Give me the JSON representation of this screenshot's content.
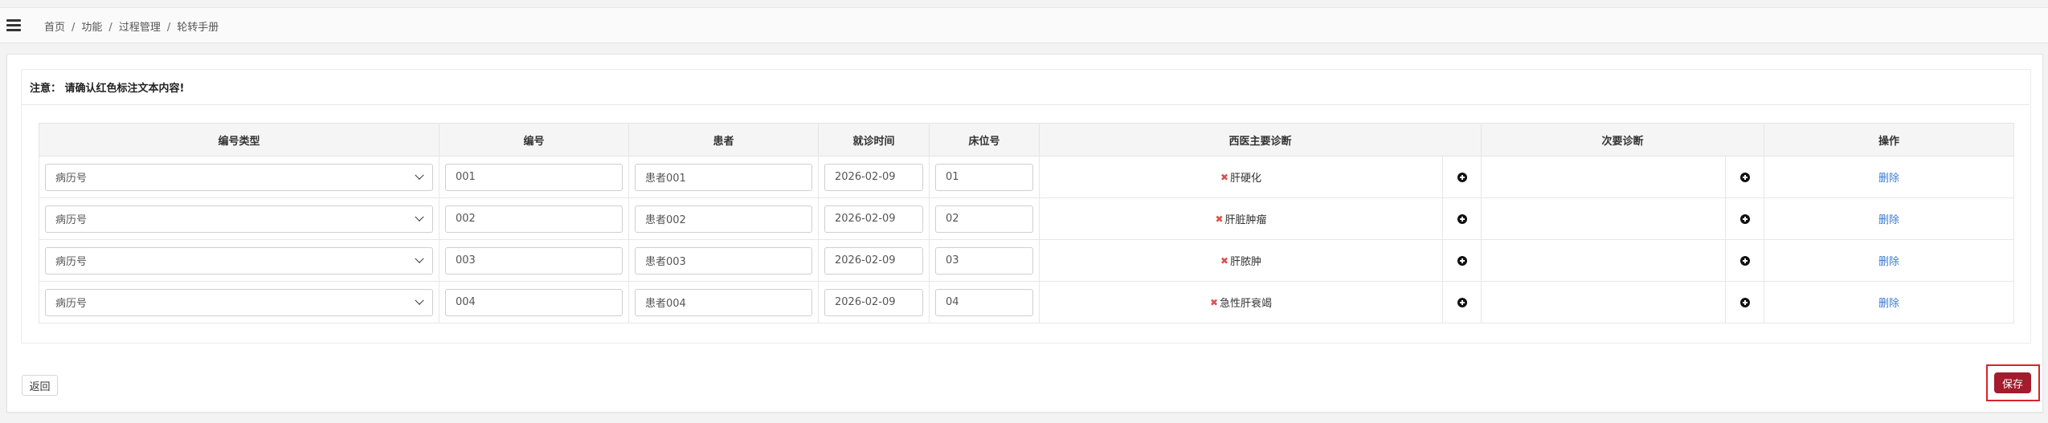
{
  "breadcrumb": {
    "items": [
      "首页",
      "功能",
      "过程管理",
      "轮转手册"
    ],
    "sep": "/"
  },
  "notice": "注意： 请确认红色标注文本内容!",
  "table": {
    "headers": [
      "编号类型",
      "编号",
      "患者",
      "就诊时间",
      "床位号",
      "西医主要诊断",
      "次要诊断",
      "操作"
    ],
    "rows": [
      {
        "type": "病历号",
        "number": "001",
        "patient": "患者001",
        "date": "2026-02-09",
        "bed": "01",
        "diagnosis": "肝硬化",
        "action": "删除"
      },
      {
        "type": "病历号",
        "number": "002",
        "patient": "患者002",
        "date": "2026-02-09",
        "bed": "02",
        "diagnosis": "肝脏肿瘤",
        "action": "删除"
      },
      {
        "type": "病历号",
        "number": "003",
        "patient": "患者003",
        "date": "2026-02-09",
        "bed": "03",
        "diagnosis": "肝脓肿",
        "action": "删除"
      },
      {
        "type": "病历号",
        "number": "004",
        "patient": "患者004",
        "date": "2026-02-09",
        "bed": "04",
        "diagnosis": "急性肝衰竭",
        "action": "删除"
      }
    ]
  },
  "icons": {
    "menu": "hamburger-menu-icon",
    "remove": "red-x-icon",
    "add": "plus-circle-icon",
    "dropdown": "chevron-down-icon"
  },
  "buttons": {
    "back": "返回",
    "save": "保存"
  },
  "colors": {
    "save_bg": "#a31b2c",
    "highlight": "#d9232e",
    "x_mark": "#d9534f",
    "link": "#3a7bd5"
  }
}
